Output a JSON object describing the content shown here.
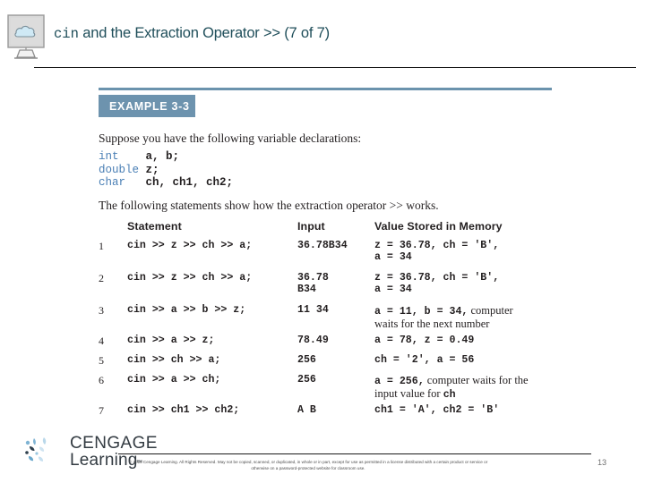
{
  "header": {
    "icon": "computer-monitor-cloud-icon",
    "title_mono": "cin",
    "title_rest": " and the Extraction Operator >> (7 of 7)"
  },
  "example": {
    "badge_label": "EXAMPLE 3-3",
    "intro_text": "Suppose you have the following variable declarations:",
    "code_lines": [
      {
        "keyword": "int",
        "rest": "    a, b;"
      },
      {
        "keyword": "double",
        "rest": " z;"
      },
      {
        "keyword": "char",
        "rest": "   ch, ch1, ch2;"
      }
    ],
    "follow_text": "The following statements show how the extraction operator >> works."
  },
  "table": {
    "headers": {
      "number": "",
      "statement": "Statement",
      "input": "Input",
      "value": "Value Stored in Memory"
    },
    "rows": [
      {
        "number": "1",
        "statement": "cin >> z >> ch >> a;",
        "input_line1": "36.78B34",
        "input_line2": "",
        "value_line1": "z = 36.78, ch = 'B',",
        "value_line2": "a = 34",
        "value_line1_plain": "",
        "value_line2_plain": ""
      },
      {
        "number": "2",
        "statement": "cin >> z >> ch >> a;",
        "input_line1": "36.78",
        "input_line2": "B34",
        "value_line1": "z = 36.78, ch = 'B',",
        "value_line2": "a = 34",
        "value_line1_plain": "",
        "value_line2_plain": ""
      },
      {
        "number": "3",
        "statement": "cin >> a >> b >> z;",
        "input_line1": "11 34",
        "input_line2": "",
        "value_line1": "a = 11, b = 34,",
        "value_line2": "",
        "value_line1_plain": " computer",
        "value_line2_plain": "waits for the next number"
      },
      {
        "number": "4",
        "statement": "cin >> a >> z;",
        "input_line1": "78.49",
        "input_line2": "",
        "value_line1": "a = 78, z = 0.49",
        "value_line2": "",
        "value_line1_plain": "",
        "value_line2_plain": ""
      },
      {
        "number": "5",
        "statement": "cin >> ch >> a;",
        "input_line1": "256",
        "input_line2": "",
        "value_line1": "ch = '2', a = 56",
        "value_line2": "",
        "value_line1_plain": "",
        "value_line2_plain": ""
      },
      {
        "number": "6",
        "statement": "cin >> a >> ch;",
        "input_line1": "256",
        "input_line2": "",
        "value_line1": "a = 256,",
        "value_line2": "ch",
        "value_line1_plain": " computer waits for the",
        "value_line2_plain": "input value for "
      },
      {
        "number": "7",
        "statement": "cin >> ch1 >> ch2;",
        "input_line1": "A B",
        "input_line2": "",
        "value_line1": "ch1 = 'A', ch2 = 'B'",
        "value_line2": "",
        "value_line1_plain": "",
        "value_line2_plain": ""
      }
    ]
  },
  "footer": {
    "logo_line1": "CENGAGE",
    "logo_line2": "Learning",
    "logo_tm": "™",
    "copyright": "© 2018 Cengage Learning. All Rights Reserved. May not be copied, scanned, or duplicated, in whole or in part, except for use as permitted in a license distributed with a certain product or service or otherwise on a password-protected website for classroom use.",
    "page_number": "13"
  },
  "colors": {
    "accent_blue": "#6d93ae",
    "title_teal": "#1f4e5a",
    "keyword_blue": "#4a7fb5",
    "logo_gray": "#333b42"
  }
}
